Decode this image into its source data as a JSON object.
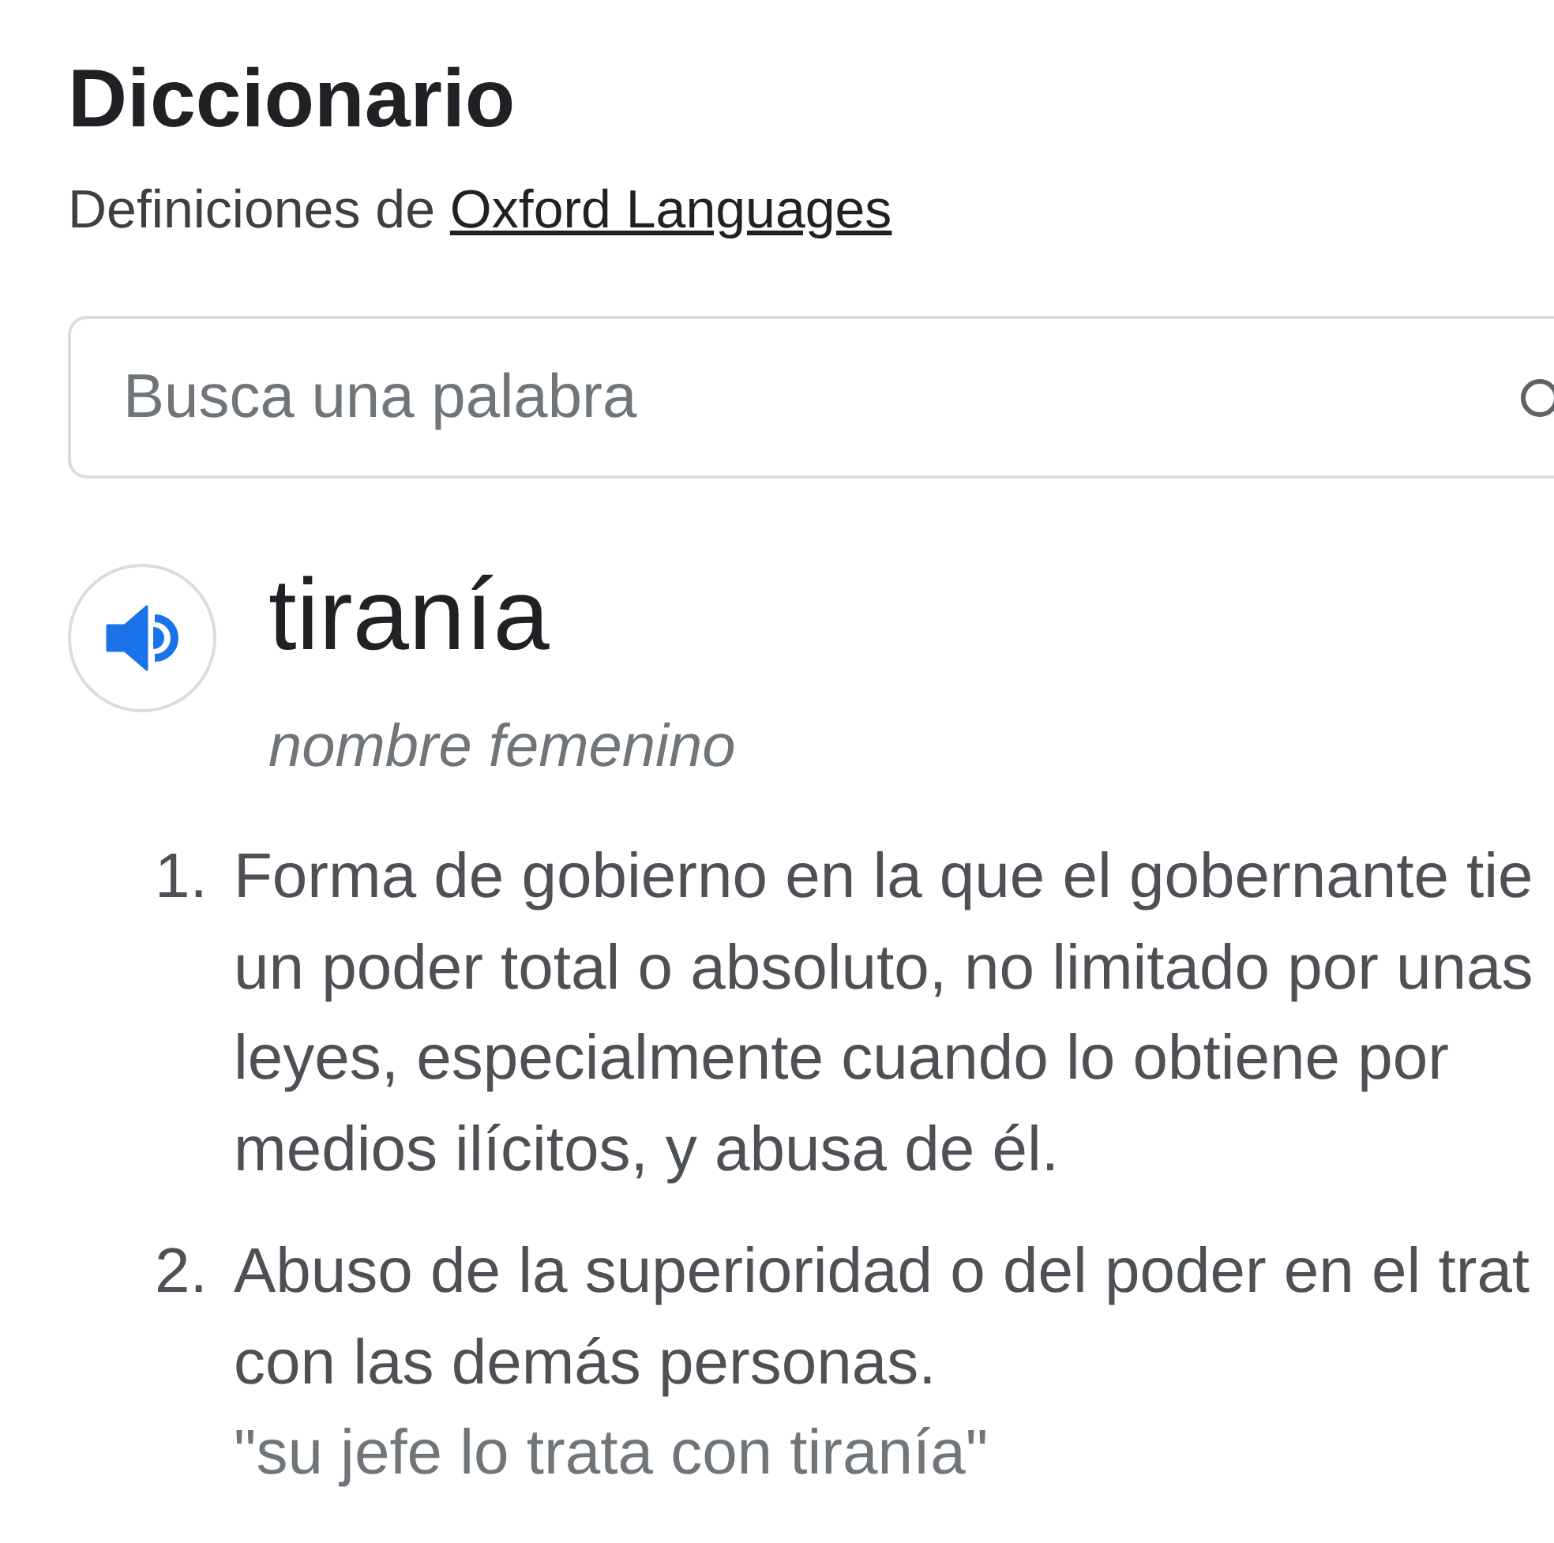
{
  "header": {
    "title": "Diccionario",
    "source_prefix": "Definiciones de",
    "source_link": "Oxford Languages"
  },
  "search": {
    "placeholder": "Busca una palabra"
  },
  "entry": {
    "word": "tiranía",
    "part_of_speech": "nombre femenino",
    "definitions": [
      {
        "number": "1.",
        "lines": [
          "Forma de gobierno en la que el gobernante tie",
          "un poder total o absoluto, no limitado por unas",
          "leyes, especialmente cuando lo obtiene por",
          "medios ilícitos, y abusa de él."
        ]
      },
      {
        "number": "2.",
        "lines": [
          "Abuso de la superioridad o del poder en el trat",
          "con las demás personas."
        ],
        "example": "\"su jefe lo trata con tiranía\""
      }
    ]
  }
}
